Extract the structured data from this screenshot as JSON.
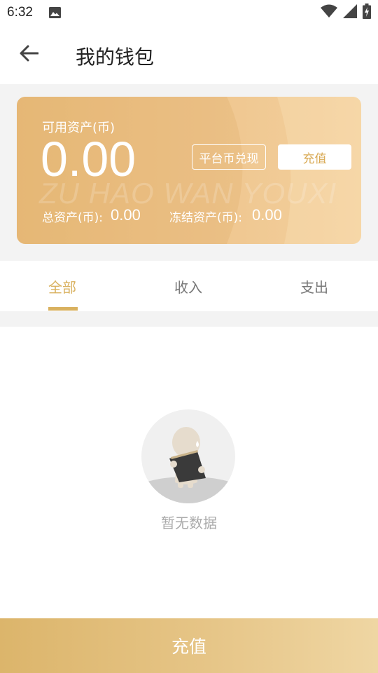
{
  "status_bar": {
    "time": "6:32",
    "icons": [
      "image-icon",
      "wifi-icon",
      "signal-icon",
      "battery-icon"
    ]
  },
  "header": {
    "title": "我的钱包",
    "back_icon": "back-arrow-icon"
  },
  "wallet": {
    "available_label": "可用资产(币)",
    "available_value": "0.00",
    "exchange_button": "平台币兑现",
    "recharge_button": "充值",
    "watermark": "ZU HAO WAN YOUXI",
    "total_label": "总资产(币):",
    "total_value": "0.00",
    "frozen_label": "冻结资产(币):",
    "frozen_value": "0.00"
  },
  "tabs": [
    {
      "label": "全部",
      "active": true
    },
    {
      "label": "收入",
      "active": false
    },
    {
      "label": "支出",
      "active": false
    }
  ],
  "empty_state": {
    "text": "暂无数据"
  },
  "bottom_button": {
    "label": "充值"
  },
  "colors": {
    "accent": "#d9b15f",
    "card_start": "#e9bd7d",
    "card_end": "#f3d09d",
    "background_band": "#f3f3f3"
  }
}
